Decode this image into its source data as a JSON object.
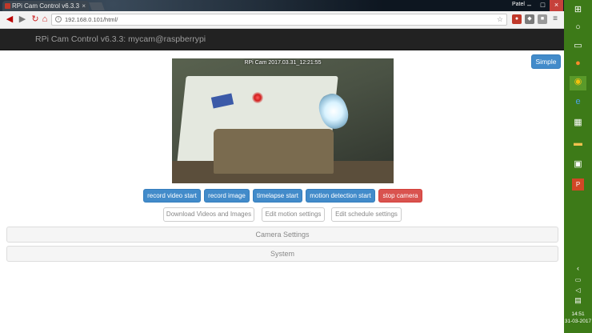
{
  "browser": {
    "tab_title": "RPi Cam Control v6.3.3",
    "user": "Patel",
    "url": "192.168.0.101/html/"
  },
  "page": {
    "brand": "RPi Cam Control v6.3.3: mycam@raspberrypi",
    "simple_label": "Simple",
    "camera_overlay": "RPi Cam  2017.03.31_12:21:55",
    "buttons": {
      "record_video": "record video start",
      "record_image": "record image",
      "timelapse": "timelapse start",
      "motion_detection": "motion detection start",
      "stop_camera": "stop camera"
    },
    "links": {
      "download": "Download Videos and Images",
      "edit_motion": "Edit motion settings",
      "edit_schedule": "Edit schedule settings"
    },
    "panels": {
      "camera_settings": "Camera Settings",
      "system": "System"
    }
  },
  "taskbar": {
    "time": "14:51",
    "date": "31-03-2017"
  },
  "colors": {
    "primary": "#428bca",
    "danger": "#d9534f",
    "navbar": "#222222",
    "taskbar": "#3d7a18"
  }
}
